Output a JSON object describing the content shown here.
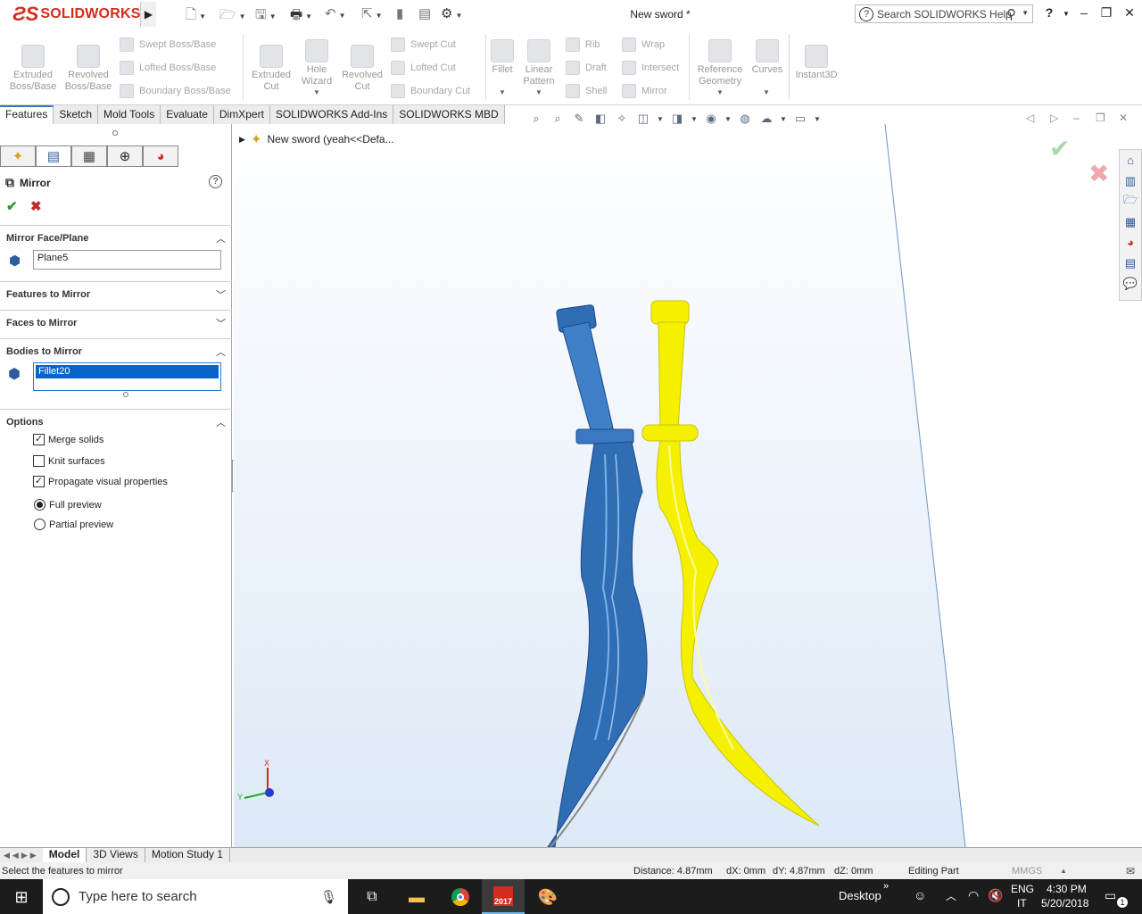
{
  "app": {
    "brand": "SOLIDWORKS",
    "doc_title": "New sword *"
  },
  "search": {
    "placeholder": "Search SOLIDWORKS Help"
  },
  "title_buttons": {
    "help": "?",
    "minimize": "–",
    "restore": "❐",
    "close": "✕"
  },
  "command_manager": {
    "big_buttons": [
      {
        "label": "Extruded\nBoss/Base"
      },
      {
        "label": "Revolved\nBoss/Base"
      },
      {
        "label": "Extruded\nCut"
      },
      {
        "label": "Hole\nWizard"
      },
      {
        "label": "Revolved\nCut"
      },
      {
        "label": "Fillet"
      },
      {
        "label": "Linear\nPattern"
      },
      {
        "label": "Reference\nGeometry"
      },
      {
        "label": "Curves"
      },
      {
        "label": "Instant3D"
      }
    ],
    "small_buttons": [
      "Swept Boss/Base",
      "Lofted Boss/Base",
      "Boundary Boss/Base",
      "Swept Cut",
      "Lofted Cut",
      "Boundary Cut",
      "Rib",
      "Draft",
      "Shell",
      "Wrap",
      "Intersect",
      "Mirror"
    ]
  },
  "tabs": [
    "Features",
    "Sketch",
    "Mold Tools",
    "Evaluate",
    "DimXpert",
    "SOLIDWORKS Add-Ins",
    "SOLIDWORKS MBD"
  ],
  "property_manager": {
    "title": "Mirror",
    "sections": {
      "mirror_face": {
        "title": "Mirror Face/Plane",
        "value": "Plane5"
      },
      "features": {
        "title": "Features to Mirror"
      },
      "faces": {
        "title": "Faces to Mirror"
      },
      "bodies": {
        "title": "Bodies to Mirror",
        "value": "Fillet20"
      },
      "options": {
        "title": "Options",
        "merge_solids": "Merge solids",
        "knit_surfaces": "Knit surfaces",
        "propagate": "Propagate visual properties",
        "full_preview": "Full preview",
        "partial_preview": "Partial preview"
      }
    },
    "state": {
      "merge_solids": true,
      "knit_surfaces": false,
      "propagate": true,
      "preview": "full"
    }
  },
  "tree": {
    "root": "New sword  (yeah<<Defa..."
  },
  "triad": {
    "x": "X",
    "y": "Y"
  },
  "bottom_tabs": [
    "Model",
    "3D Views",
    "Motion Study 1"
  ],
  "status": {
    "hint": "Select the features to mirror",
    "distance": "Distance: 4.87mm",
    "dx": "dX: 0mm",
    "dy": "dY: 4.87mm",
    "dz": "dZ: 0mm",
    "mode": "Editing Part",
    "units": "MMGS"
  },
  "taskbar": {
    "search_placeholder": "Type here to search",
    "desktop": "Desktop",
    "lang": "ENG",
    "lang2": "IT",
    "time": "4:30 PM",
    "date": "5/20/2018",
    "notif_count": "1",
    "sw_badge": "2017"
  },
  "colors": {
    "accent": "#2d7ac8",
    "blue_body": "#2f6db5",
    "yellow_body": "#f5f000",
    "taskbar": "#1c1c1c"
  }
}
